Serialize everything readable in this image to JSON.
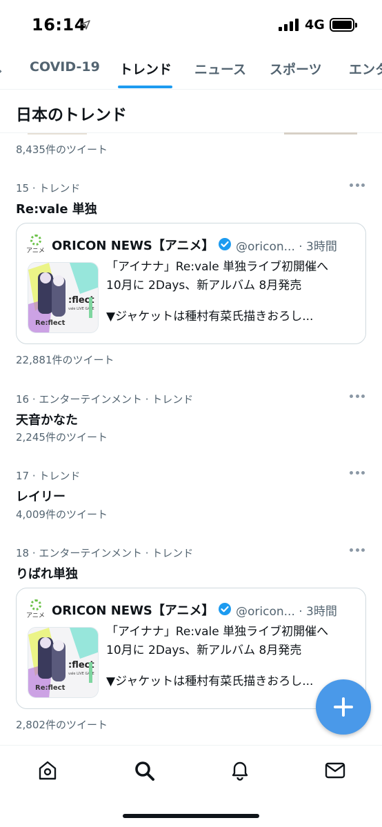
{
  "status_bar": {
    "time": "16:14",
    "network": "4G",
    "signal_bars": 4,
    "battery_level": 1.0
  },
  "tabs": [
    {
      "label": "COVID-19",
      "active": false
    },
    {
      "label": "トレンド",
      "active": true
    },
    {
      "label": "ニュース",
      "active": false
    },
    {
      "label": "スポーツ",
      "active": false
    },
    {
      "label": "エンタ",
      "active": false
    }
  ],
  "section": {
    "title": "日本のトレンド"
  },
  "previous_item": {
    "count": "8,435件のツイート"
  },
  "trends": [
    {
      "meta": "15 · トレンド",
      "title": "Re:vale 単独",
      "count": "22,881件のツイート",
      "card": {
        "avatar_text": "アニメ",
        "name": "ORICON NEWS【アニメ】",
        "handle": "@oricon... · 3時間",
        "line1": "「アイナナ」Re:vale 単独ライブ初開催へ",
        "line2": "10月に 2Days、新アルバム 8月発売",
        "line3": "▼ジャケットは種村有菜氏描きおろし..."
      }
    },
    {
      "meta": "16 · エンターテインメント · トレンド",
      "title": "天音かなた",
      "count": "2,245件のツイート"
    },
    {
      "meta": "17 · トレンド",
      "title": "レイリー",
      "count": "4,009件のツイート"
    },
    {
      "meta": "18 · エンターテインメント · トレンド",
      "title": "りばれ単独",
      "count": "2,802件のツイート",
      "card": {
        "avatar_text": "アニメ",
        "name": "ORICON NEWS【アニメ】",
        "handle": "@oricon... · 3時間",
        "line1": "「アイナナ」Re:vale 単独ライブ初開催へ",
        "line2": "10月に 2Days、新アルバム 8月発売",
        "line3": "▼ジャケットは種村有菜氏描きおろし..."
      }
    }
  ],
  "colors": {
    "accent": "#1d9bf0",
    "fab": "#4a99e9",
    "secondary_text": "#536471",
    "verified": "#1d9bf0"
  },
  "icons": {
    "fab": "plus-icon",
    "nav": [
      "home-icon",
      "search-icon",
      "bell-icon",
      "mail-icon"
    ]
  }
}
